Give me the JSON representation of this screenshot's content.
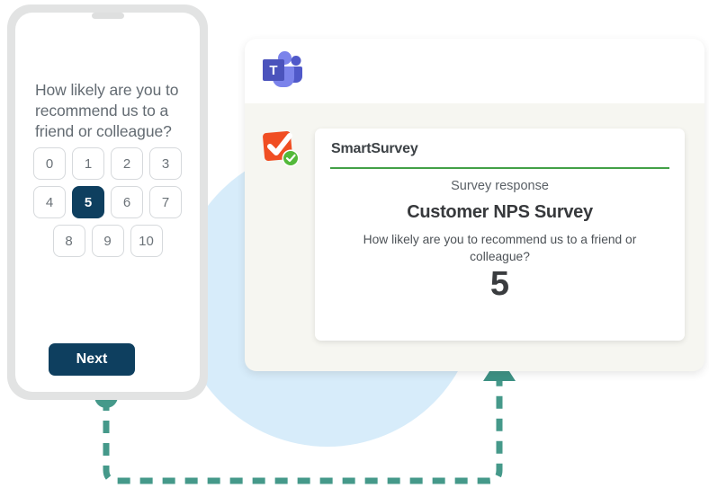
{
  "phone": {
    "question": "How likely are you to recommend us to a friend or colleague?",
    "scale": {
      "rows": [
        [
          "0",
          "1",
          "2",
          "3"
        ],
        [
          "4",
          "5",
          "6",
          "7"
        ],
        [
          "8",
          "9",
          "10"
        ]
      ],
      "selected": "5"
    },
    "next_label": "Next"
  },
  "teams_card": {
    "logo_letter": "T",
    "app_icon_name": "smartsurvey-icon",
    "response_card": {
      "app_name": "SmartSurvey",
      "kicker": "Survey response",
      "title": "Customer NPS Survey",
      "question": "How likely are you to recommend us to a friend or colleague?",
      "value": "5"
    }
  },
  "colors": {
    "navy": "#0e3f5f",
    "teal": "#45998a",
    "teams_purple": "#5b5fc7",
    "smartsurvey_orange": "#f04e23",
    "badge_green": "#53b93a",
    "rule_green": "#43a047",
    "bg_circle_blue": "#d7ecfa",
    "card_bg": "#f6f6f1"
  }
}
